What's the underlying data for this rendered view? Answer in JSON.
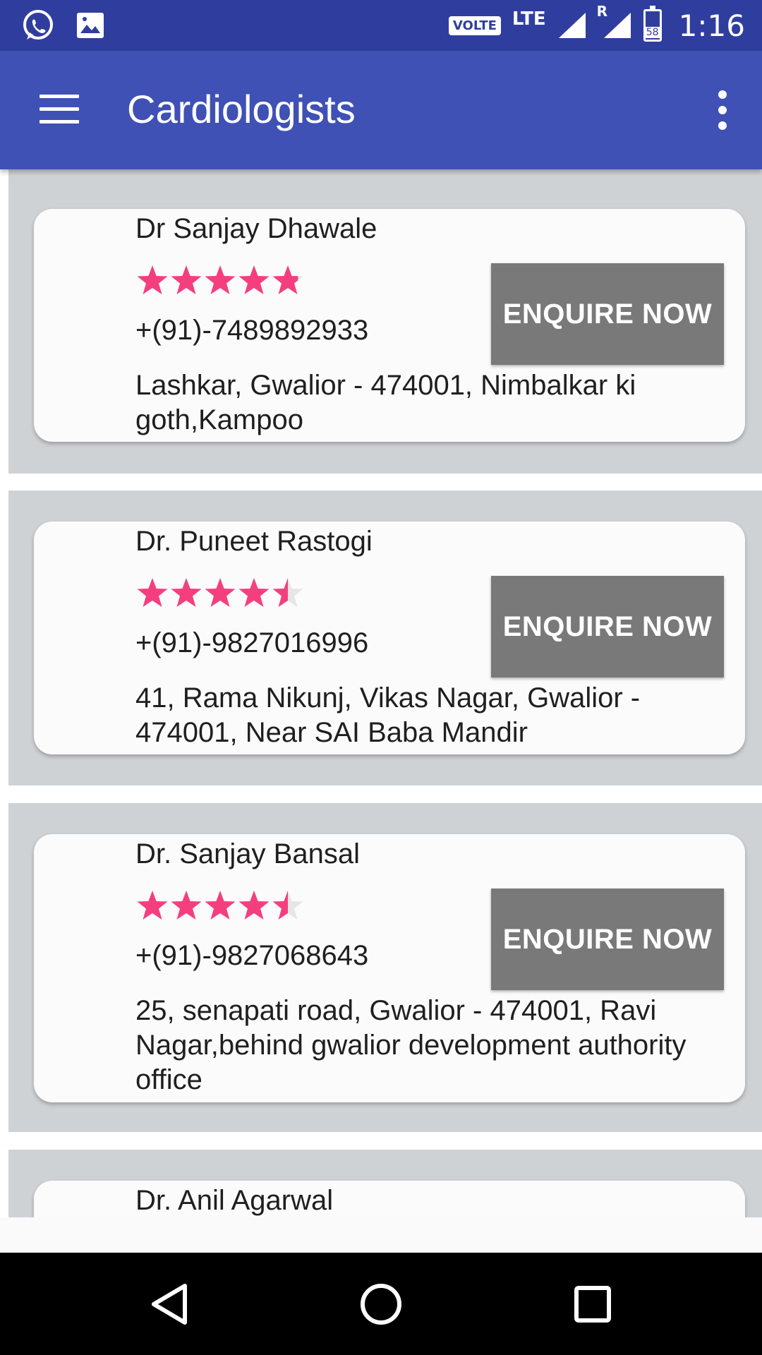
{
  "status_bar": {
    "volte": "VOLTE",
    "network": "LTE",
    "roaming": "R",
    "battery": "58",
    "time": "1:16",
    "icons": [
      "whatsapp-icon",
      "image-icon",
      "signal-icon",
      "battery-icon"
    ]
  },
  "app_bar": {
    "title": "Cardiologists",
    "icons": [
      "menu-icon",
      "more-vert-icon"
    ]
  },
  "accent_colors": {
    "app_bar": "#3f51b5",
    "status_bar": "#2f3e9e",
    "star": "#f43f7f",
    "button": "#7a797a"
  },
  "doctors": [
    {
      "name": "Dr Sanjay Dhawale",
      "rating": 4.8,
      "phone": "+(91)-7489892933",
      "address": "Lashkar, Gwalior - 474001, Nimbalkar ki goth,Kampoo",
      "button": "ENQUIRE NOW"
    },
    {
      "name": "Dr. Puneet Rastogi",
      "rating": 4.5,
      "phone": "+(91)-9827016996",
      "address": "41, Rama Nikunj, Vikas Nagar, Gwalior - 474001, Near SAI Baba Mandir",
      "button": "ENQUIRE NOW"
    },
    {
      "name": "Dr. Sanjay Bansal",
      "rating": 4.5,
      "phone": "+(91)-9827068643",
      "address": "25, senapati road, Gwalior - 474001, Ravi Nagar,behind gwalior development authority office",
      "button": "ENQUIRE NOW"
    },
    {
      "name": "Dr. Anil Agarwal"
    }
  ],
  "nav_bar": {
    "icons": [
      "back-icon",
      "home-icon",
      "recents-icon"
    ]
  }
}
